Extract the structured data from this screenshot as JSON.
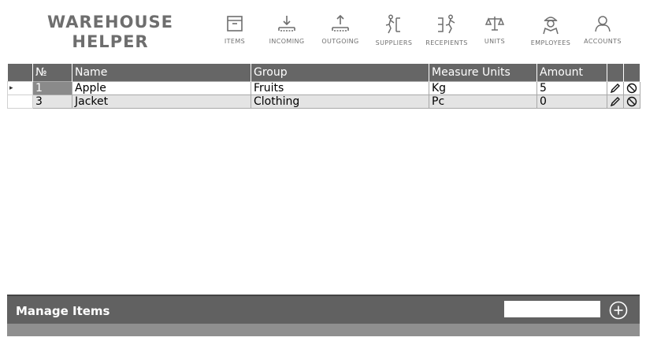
{
  "app": {
    "brand_line1": "WAREHOUSE",
    "brand_line2": "HELPER"
  },
  "nav": [
    {
      "label": "ITEMS",
      "icon": "items-icon"
    },
    {
      "label": "INCOMING",
      "icon": "incoming-icon"
    },
    {
      "label": "OUTGOING",
      "icon": "outgoing-icon"
    },
    {
      "label": "SUPPLIERS",
      "icon": "suppliers-icon"
    },
    {
      "label": "RECEPIENTS",
      "icon": "recepients-icon"
    },
    {
      "label": "UNITS",
      "icon": "units-icon"
    },
    {
      "label": "EMPLOYEES",
      "icon": "employees-icon"
    },
    {
      "label": "ACCOUNTS",
      "icon": "accounts-icon"
    }
  ],
  "table": {
    "columns": [
      "№",
      "Name",
      "Group",
      "Measure Units",
      "Amount"
    ],
    "rows": [
      {
        "id": "1",
        "name": "Apple",
        "group": "Fruits",
        "unit": "Kg",
        "amount": "5"
      },
      {
        "id": "3",
        "name": "Jacket",
        "group": "Clothing",
        "unit": "Pc",
        "amount": "0"
      }
    ],
    "current_row_marker": "▸"
  },
  "footer": {
    "title": "Manage Items",
    "search_value": ""
  },
  "colors": {
    "header_bg": "#666666",
    "footer_bg": "#616161",
    "alt_row": "#e4e4e4",
    "nav_text": "#707070"
  }
}
